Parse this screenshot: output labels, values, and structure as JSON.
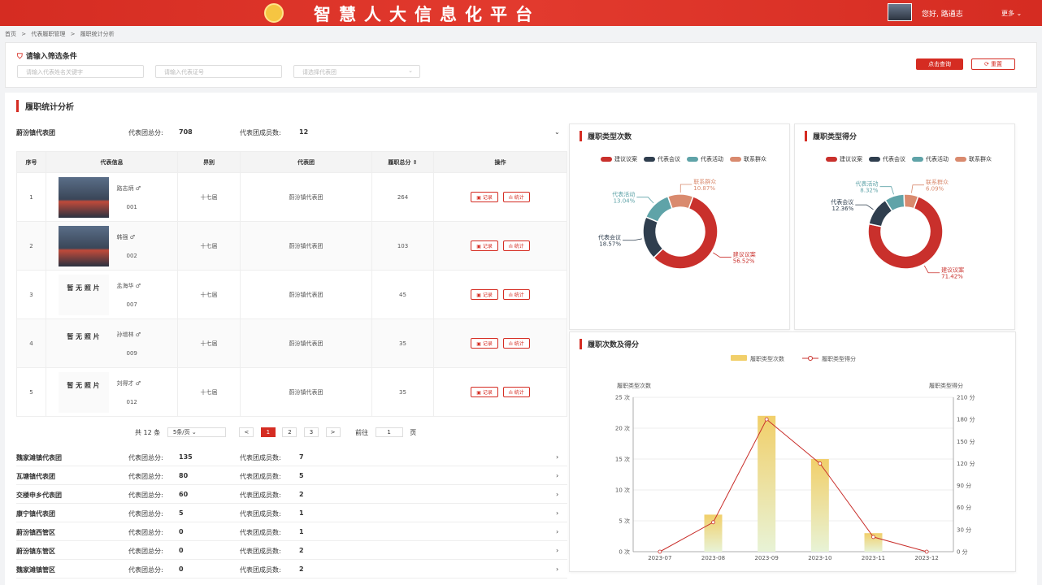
{
  "header": {
    "title": "智慧人大信息化平台",
    "greeting": "您好, 路通志",
    "more": "更多 ⌄"
  },
  "breadcrumb": [
    "首页",
    ">",
    "代表履职管理",
    ">",
    "履职统计分析"
  ],
  "filter": {
    "title": "请输入筛选条件",
    "name_placeholder": "请输入代表姓名关键字",
    "cert_placeholder": "请输入代表证号",
    "group_placeholder": "请选择代表团",
    "search_label": "点击查询",
    "reset_label": "⟳ 重置"
  },
  "section_title": "履职统计分析",
  "group": {
    "name": "蔚汾镇代表团",
    "score_label": "代表团总分:",
    "score": "708",
    "members_label": "代表团成员数:",
    "members": "12"
  },
  "table": {
    "headers": [
      "序号",
      "代表信息",
      "界别",
      "代表团",
      "履职总分 ⇕",
      "操作"
    ],
    "record_label": "▣ 记录",
    "stats_label": "ılı 统计",
    "rows": [
      {
        "no": "1",
        "name": "路志炳 ♂",
        "code": "001",
        "term": "十七届",
        "group": "蔚汾镇代表团",
        "score": "264",
        "photo": "real",
        "no_photo": ""
      },
      {
        "no": "2",
        "name": "韩强 ♂",
        "code": "002",
        "term": "十七届",
        "group": "蔚汾镇代表团",
        "score": "103",
        "photo": "real",
        "no_photo": ""
      },
      {
        "no": "3",
        "name": "孟海华 ♂",
        "code": "007",
        "term": "十七届",
        "group": "蔚汾镇代表团",
        "score": "45",
        "photo": "none",
        "no_photo": "暂 无 照 片"
      },
      {
        "no": "4",
        "name": "孙增林 ♂",
        "code": "009",
        "term": "十七届",
        "group": "蔚汾镇代表团",
        "score": "35",
        "photo": "none",
        "no_photo": "暂 无 照 片"
      },
      {
        "no": "5",
        "name": "刘得才 ♂",
        "code": "012",
        "term": "十七届",
        "group": "蔚汾镇代表团",
        "score": "35",
        "photo": "none",
        "no_photo": "暂 无 照 片"
      }
    ]
  },
  "pager": {
    "total": "共 12 条",
    "per_page": "5条/页 ⌄",
    "prev": "<",
    "pages": [
      "1",
      "2",
      "3"
    ],
    "next": ">",
    "goto": "前往",
    "page_input": "1",
    "page_unit": "页"
  },
  "other_groups": [
    {
      "name": "魏家滩镇代表团",
      "score": "135",
      "members": "7"
    },
    {
      "name": "瓦塘镇代表团",
      "score": "80",
      "members": "5"
    },
    {
      "name": "交楼申乡代表团",
      "score": "60",
      "members": "2"
    },
    {
      "name": "康宁镇代表团",
      "score": "5",
      "members": "1"
    },
    {
      "name": "蔚汾镇西管区",
      "score": "0",
      "members": "1"
    },
    {
      "name": "蔚汾镇东管区",
      "score": "0",
      "members": "2"
    },
    {
      "name": "魏家滩镇管区",
      "score": "0",
      "members": "2"
    }
  ],
  "other_labels": {
    "score_label": "代表团总分:",
    "members_label": "代表团成员数:"
  },
  "colors": {
    "red": "#c9302c",
    "navy": "#2f3e4e",
    "teal": "#5fa3a8",
    "salmon": "#d98a6e",
    "bar": "#f1cf6a"
  },
  "chart_data": [
    {
      "type": "pie",
      "title": "履职类型次数",
      "legend": [
        "建议议案",
        "代表会议",
        "代表活动",
        "联系群众"
      ],
      "values": [
        56.52,
        18.57,
        13.04,
        10.87
      ],
      "labels": [
        "建议议案\n56.52%",
        "代表会议\n18.57%",
        "代表活动\n13.04%",
        "联系群众\n10.87%"
      ]
    },
    {
      "type": "pie",
      "title": "履职类型得分",
      "legend": [
        "建议议案",
        "代表会议",
        "代表活动",
        "联系群众"
      ],
      "values": [
        71.42,
        12.36,
        8.32,
        6.09
      ],
      "labels": [
        "建议议案\n71.42%",
        "代表会议\n12.36%",
        "代表活动\n8.32%",
        "联系群众\n6.09%"
      ]
    },
    {
      "type": "bar",
      "title": "履职次数及得分",
      "legend": [
        "履职类型次数",
        "履职类型得分"
      ],
      "categories": [
        "2023-07",
        "2023-08",
        "2023-09",
        "2023-10",
        "2023-11",
        "2023-12"
      ],
      "series": [
        {
          "name": "履职类型次数",
          "type": "bar",
          "values": [
            0,
            6,
            22,
            15,
            3,
            0
          ]
        },
        {
          "name": "履职类型得分",
          "type": "line",
          "values": [
            0,
            40,
            180,
            120,
            20,
            0
          ]
        }
      ],
      "ylabel": "履职类型次数",
      "y2label": "履职类型得分",
      "ylim": [
        0,
        25
      ],
      "y2lim": [
        0,
        210
      ],
      "yticks": [
        "0 次",
        "5 次",
        "10 次",
        "15 次",
        "20 次",
        "25 次"
      ],
      "y2ticks": [
        "0 分",
        "30 分",
        "60 分",
        "90 分",
        "120 分",
        "150 分",
        "180 分",
        "210 分"
      ]
    }
  ]
}
